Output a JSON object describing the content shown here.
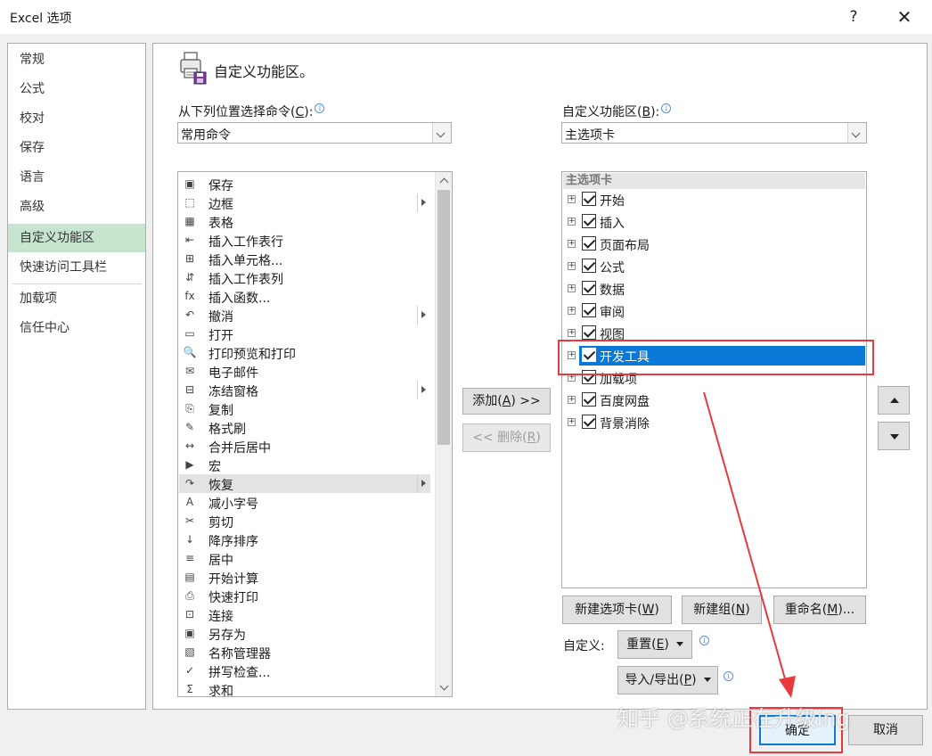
{
  "window": {
    "title": "Excel 选项",
    "help": "?",
    "close": "✕"
  },
  "nav": {
    "items": [
      {
        "label": "常规"
      },
      {
        "label": "公式"
      },
      {
        "label": "校对"
      },
      {
        "label": "保存"
      },
      {
        "label": "语言"
      },
      {
        "label": "高级"
      },
      {
        "label": "自定义功能区"
      },
      {
        "label": "快速访问工具栏"
      },
      {
        "label": "加载项"
      },
      {
        "label": "信任中心"
      }
    ],
    "active_index": 6
  },
  "main": {
    "heading": "自定义功能区。",
    "choose_label_pre": "从下列位置选择命令(",
    "choose_label_key": "C",
    "choose_label_post": "):",
    "choose_value": "常用命令",
    "customize_label_pre": "自定义功能区(",
    "customize_label_key": "B",
    "customize_label_post": "):",
    "customize_value": "主选项卡",
    "commands": [
      {
        "label": "保存",
        "icon": "save-icon",
        "glyph": "▣",
        "sub": false
      },
      {
        "label": "边框",
        "icon": "border-icon",
        "glyph": "⬚",
        "sub": true
      },
      {
        "label": "表格",
        "icon": "table-icon",
        "glyph": "▦",
        "sub": false
      },
      {
        "label": "插入工作表行",
        "icon": "insert-rows-icon",
        "glyph": "⇤",
        "sub": false
      },
      {
        "label": "插入单元格...",
        "icon": "insert-cells-icon",
        "glyph": "⊞",
        "sub": false
      },
      {
        "label": "插入工作表列",
        "icon": "insert-columns-icon",
        "glyph": "⇵",
        "sub": false
      },
      {
        "label": "插入函数...",
        "icon": "function-icon",
        "glyph": "fx",
        "sub": false
      },
      {
        "label": "撤消",
        "icon": "undo-icon",
        "glyph": "↶",
        "sub": true
      },
      {
        "label": "打开",
        "icon": "folder-icon",
        "glyph": "▭",
        "sub": false
      },
      {
        "label": "打印预览和打印",
        "icon": "print-preview-icon",
        "glyph": "🔍",
        "sub": false
      },
      {
        "label": "电子邮件",
        "icon": "email-icon",
        "glyph": "✉",
        "sub": false
      },
      {
        "label": "冻结窗格",
        "icon": "freeze-panes-icon",
        "glyph": "⊟",
        "sub": true
      },
      {
        "label": "复制",
        "icon": "copy-icon",
        "glyph": "⎘",
        "sub": false
      },
      {
        "label": "格式刷",
        "icon": "format-painter-icon",
        "glyph": "✎",
        "sub": false
      },
      {
        "label": "合并后居中",
        "icon": "merge-center-icon",
        "glyph": "↔",
        "sub": false
      },
      {
        "label": "宏",
        "icon": "macro-icon",
        "glyph": "▶",
        "sub": false
      },
      {
        "label": "恢复",
        "icon": "redo-icon",
        "glyph": "↷",
        "sub": true
      },
      {
        "label": "减小字号",
        "icon": "font-decrease-icon",
        "glyph": "A",
        "sub": false
      },
      {
        "label": "剪切",
        "icon": "cut-icon",
        "glyph": "✂",
        "sub": false
      },
      {
        "label": "降序排序",
        "icon": "sort-descending-icon",
        "glyph": "↓",
        "sub": false
      },
      {
        "label": "居中",
        "icon": "align-center-icon",
        "glyph": "≡",
        "sub": false
      },
      {
        "label": "开始计算",
        "icon": "calculator-icon",
        "glyph": "▤",
        "sub": false
      },
      {
        "label": "快速打印",
        "icon": "quick-print-icon",
        "glyph": "⎙",
        "sub": false
      },
      {
        "label": "连接",
        "icon": "connections-icon",
        "glyph": "⊡",
        "sub": false
      },
      {
        "label": "另存为",
        "icon": "save-as-icon",
        "glyph": "▣",
        "sub": false
      },
      {
        "label": "名称管理器",
        "icon": "name-manager-icon",
        "glyph": "▧",
        "sub": false
      },
      {
        "label": "拼写检查...",
        "icon": "spelling-icon",
        "glyph": "✓",
        "sub": false
      },
      {
        "label": "求和",
        "icon": "sum-icon",
        "glyph": "Σ",
        "sub": false
      }
    ],
    "selected_command_index": 16,
    "add_pre": "添加(",
    "add_key": "A",
    "add_post": ") >>",
    "remove_pre": "<< 删除(",
    "remove_key": "R",
    "remove_post": ")",
    "tree_header": "主选项卡",
    "tabs": [
      {
        "label": "开始",
        "checked": true
      },
      {
        "label": "插入",
        "checked": true
      },
      {
        "label": "页面布局",
        "checked": true
      },
      {
        "label": "公式",
        "checked": true
      },
      {
        "label": "数据",
        "checked": true
      },
      {
        "label": "审阅",
        "checked": true
      },
      {
        "label": "视图",
        "checked": true
      },
      {
        "label": "开发工具",
        "checked": true
      },
      {
        "label": "加载项",
        "checked": true
      },
      {
        "label": "百度网盘",
        "checked": true
      },
      {
        "label": "背景消除",
        "checked": true
      }
    ],
    "selected_tab_index": 7,
    "new_tab_pre": "新建选项卡(",
    "new_tab_key": "W",
    "new_tab_post": ")",
    "new_group_pre": "新建组(",
    "new_group_key": "N",
    "new_group_post": ")",
    "rename_pre": "重命名(",
    "rename_key": "M",
    "rename_post": ")...",
    "customize_text": "自定义:",
    "reset_pre": "重置(",
    "reset_key": "E",
    "reset_post": ")",
    "import_export_pre": "导入/导出(",
    "import_export_key": "P",
    "import_export_post": ")"
  },
  "footer": {
    "ok": "确定",
    "cancel": "取消"
  },
  "watermark": "知乎 @系统正在升级ing",
  "colors": {
    "accent": "#0a78d7",
    "nav_active": "#c6e5cf",
    "annotation": "#e8393c"
  }
}
